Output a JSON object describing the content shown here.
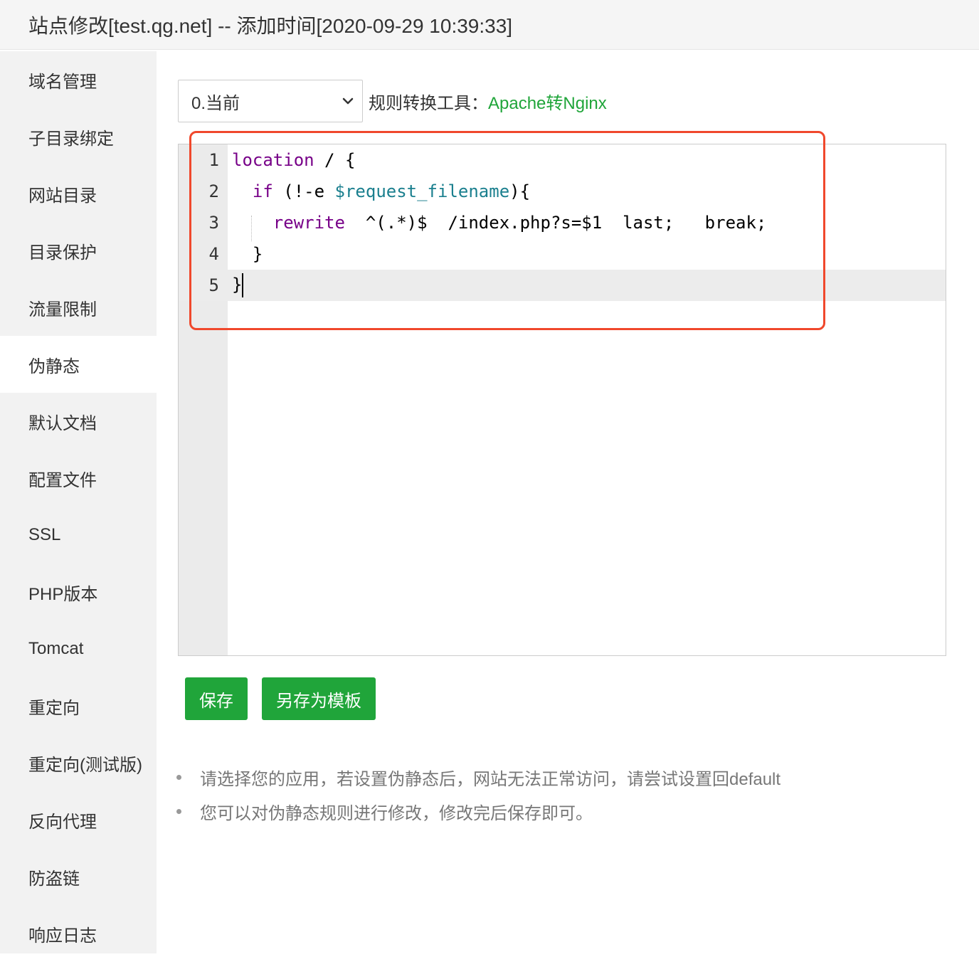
{
  "window": {
    "title": "站点修改[test.qg.net] -- 添加时间[2020-09-29 10:39:33]"
  },
  "sidebar": {
    "items": [
      {
        "label": "域名管理"
      },
      {
        "label": "子目录绑定"
      },
      {
        "label": "网站目录"
      },
      {
        "label": "目录保护"
      },
      {
        "label": "流量限制"
      },
      {
        "label": "伪静态",
        "active": true
      },
      {
        "label": "默认文档"
      },
      {
        "label": "配置文件"
      },
      {
        "label": "SSL"
      },
      {
        "label": "PHP版本"
      },
      {
        "label": "Tomcat"
      },
      {
        "label": "重定向"
      },
      {
        "label": "重定向(测试版)"
      },
      {
        "label": "反向代理"
      },
      {
        "label": "防盗链"
      },
      {
        "label": "响应日志"
      }
    ]
  },
  "toolbar": {
    "template_select_value": "0.当前",
    "tool_label": "规则转换工具：",
    "tool_link": "Apache转Nginx"
  },
  "editor": {
    "line_numbers": [
      "1",
      "2",
      "3",
      "4",
      "5"
    ],
    "lines": [
      {
        "kw": "location",
        "rest": " / {"
      },
      {
        "indent": "  ",
        "kw": "if",
        "mid": " (!-e ",
        "var": "$request_filename",
        "rest": "){"
      },
      {
        "indent": "    ",
        "kw": "rewrite",
        "rest": "  ^(.*)$  /index.php?s=$1  last;   break;"
      },
      {
        "text": "  }"
      },
      {
        "text": "}"
      }
    ]
  },
  "buttons": {
    "save": "保存",
    "save_as_template": "另存为模板"
  },
  "notes": [
    "请选择您的应用，若设置伪静态后，网站无法正常访问，请尝试设置回default",
    "您可以对伪静态规则进行修改，修改完后保存即可。"
  ],
  "colors": {
    "accent": "#20a53a",
    "highlight_box": "#f0482c"
  }
}
